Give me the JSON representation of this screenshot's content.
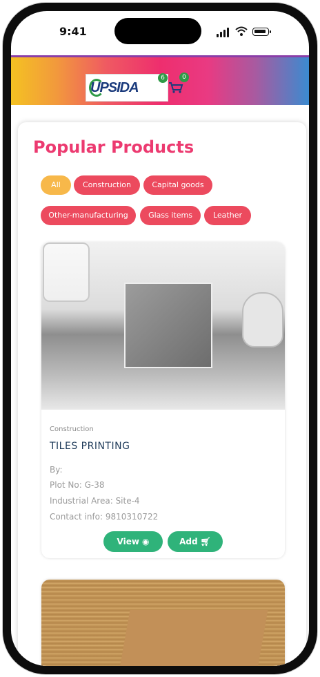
{
  "status_bar": {
    "time": "9:41"
  },
  "header": {
    "logo_text": "UPSIDA",
    "logo_badge": "6",
    "cart_count": "0",
    "colors": {
      "start": "#f4c222",
      "mid": "#ee2e6e",
      "end": "#3b8bd0"
    }
  },
  "section": {
    "title": "Popular Products"
  },
  "filters": [
    {
      "label": "All",
      "active": true
    },
    {
      "label": "Construction",
      "active": false
    },
    {
      "label": "Capital goods",
      "active": false
    },
    {
      "label": "Other-manufacturing",
      "active": false
    },
    {
      "label": "Glass items",
      "active": false
    },
    {
      "label": "Leather",
      "active": false
    }
  ],
  "products": [
    {
      "category": "Construction",
      "name": "TILES PRINTING",
      "by": "By:",
      "plot": "Plot No: G-38",
      "area": "Industrial Area: Site-4",
      "contact": "Contact info: 9810310722",
      "view_label": "View",
      "add_label": "Add"
    }
  ],
  "colors": {
    "accent": "#ec3a70",
    "pill": "#ec4a5e",
    "pill_active": "#f7b84a",
    "button": "#2fb37a"
  }
}
